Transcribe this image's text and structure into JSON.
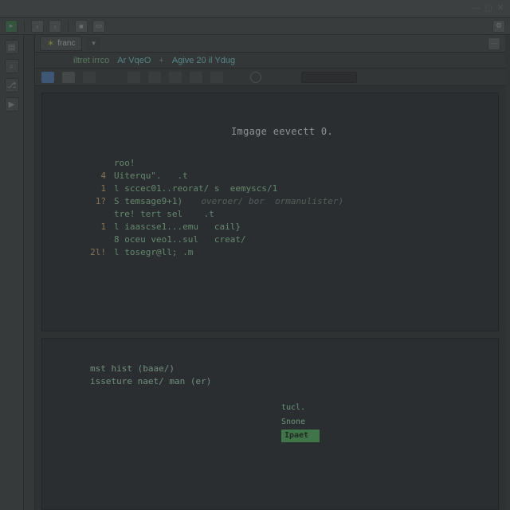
{
  "titlebar": {
    "text": ""
  },
  "tabs": [
    {
      "label": "franc",
      "dirty": true
    }
  ],
  "breadcrumb": {
    "seg1": "iltret irrco",
    "seg2": "Ar VqeO",
    "plus": "+",
    "seg3": "Agive 20 il Ydug"
  },
  "code": {
    "title": "Imgage  eevectt 0.",
    "lines": [
      {
        "gut": "",
        "t1": "roo!"
      },
      {
        "gut": "4",
        "t1": "Uiterqu\".   .t"
      },
      {
        "gut": "1",
        "t1": "l sccec01..reorat/ s  eemyscs/1"
      },
      {
        "gut": "1?",
        "t1": "S temsage9+1)  ",
        "t2": "overoer/ bor  ormanulister)"
      },
      {
        "gut": "",
        "t1": ""
      },
      {
        "gut": "",
        "t1": "tre! tert sel    .t"
      },
      {
        "gut": "1",
        "t1": "l iaascse1...emu   cail}"
      },
      {
        "gut": " ",
        "t1": "8 oceu veo1..sul   creat/"
      },
      {
        "gut": "2l!",
        "t1": "l tosegr@ll; .m"
      }
    ]
  },
  "bottom": {
    "l1": "mst hist (baae/)",
    "l2": "isseture naet/ man (er)"
  },
  "completion": {
    "items": [
      "tucl.",
      "Snone"
    ],
    "selected": "Ipaet"
  }
}
